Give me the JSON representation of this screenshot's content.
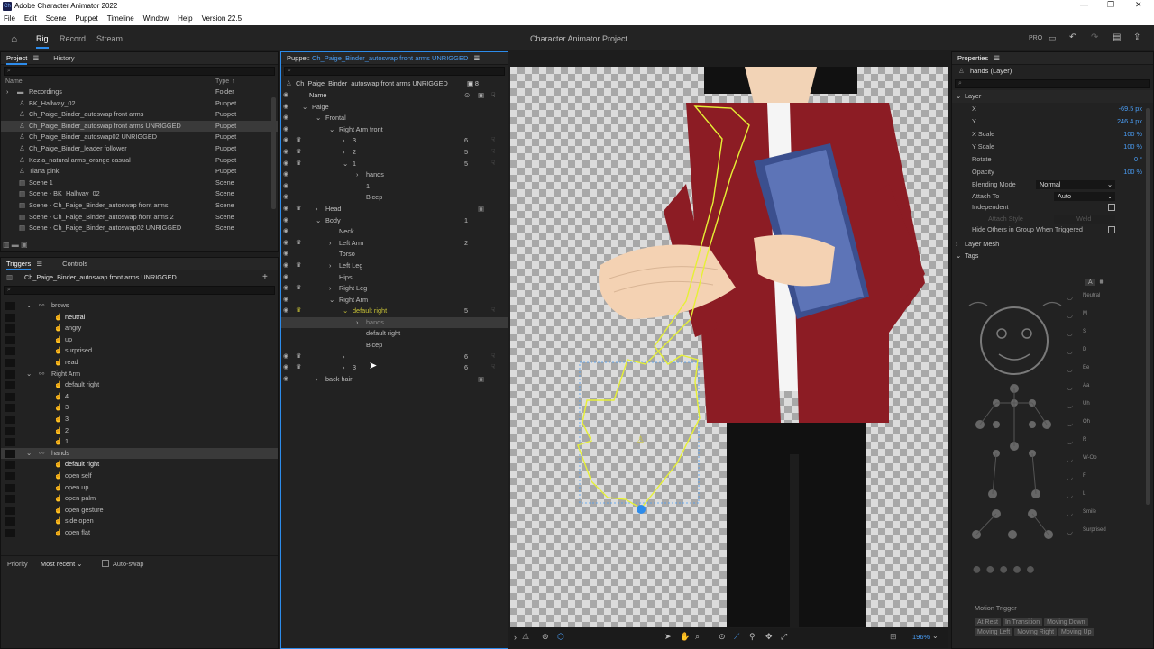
{
  "window": {
    "title": "Adobe Character Animator 2022"
  },
  "menu": [
    "File",
    "Edit",
    "Scene",
    "Puppet",
    "Timeline",
    "Window",
    "Help",
    "Version 22.5"
  ],
  "modes": {
    "rig": "Rig",
    "record": "Record",
    "stream": "Stream"
  },
  "project_title": "Character Animator Project",
  "pro": "PRO",
  "project_panel": {
    "tabs": {
      "project": "Project",
      "history": "History"
    },
    "col_name": "Name",
    "col_type": "Type",
    "items": [
      {
        "name": "Recordings",
        "type": "Folder"
      },
      {
        "name": "BK_Hallway_02",
        "type": "Puppet"
      },
      {
        "name": "Ch_Paige_Binder_autoswap front arms",
        "type": "Puppet"
      },
      {
        "name": "Ch_Paige_Binder_autoswap front arms UNRIGGED",
        "type": "Puppet"
      },
      {
        "name": "Ch_Paige_Binder_autoswap02 UNRIGGED",
        "type": "Puppet"
      },
      {
        "name": "Ch_Paige_Binder_leader follower",
        "type": "Puppet"
      },
      {
        "name": "Kezia_natural arms_orange casual",
        "type": "Puppet"
      },
      {
        "name": "Tiana pink",
        "type": "Puppet"
      },
      {
        "name": "Scene 1",
        "type": "Scene"
      },
      {
        "name": "Scene - BK_Hallway_02",
        "type": "Scene"
      },
      {
        "name": "Scene - Ch_Paige_Binder_autoswap front arms",
        "type": "Scene"
      },
      {
        "name": "Scene - Ch_Paige_Binder_autoswap front arms 2",
        "type": "Scene"
      },
      {
        "name": "Scene - Ch_Paige_Binder_autoswap02 UNRIGGED",
        "type": "Scene"
      }
    ]
  },
  "triggers_panel": {
    "tabs": {
      "triggers": "Triggers",
      "controls": "Controls"
    },
    "puppet": "Ch_Paige_Binder_autoswap front arms UNRIGGED",
    "rows": [
      {
        "label": "brows",
        "lvl": 0
      },
      {
        "label": "neutral",
        "lvl": 1
      },
      {
        "label": "angry",
        "lvl": 1
      },
      {
        "label": "up",
        "lvl": 1
      },
      {
        "label": "surprised",
        "lvl": 1
      },
      {
        "label": "read",
        "lvl": 1
      },
      {
        "label": "Right Arm",
        "lvl": 0
      },
      {
        "label": "default right",
        "lvl": 1
      },
      {
        "label": "4",
        "lvl": 1
      },
      {
        "label": "3",
        "lvl": 1
      },
      {
        "label": "3",
        "lvl": 1
      },
      {
        "label": "2",
        "lvl": 1
      },
      {
        "label": "1",
        "lvl": 1
      },
      {
        "label": "hands",
        "lvl": 0
      },
      {
        "label": "default right",
        "lvl": 1
      },
      {
        "label": "open self",
        "lvl": 1
      },
      {
        "label": "open up",
        "lvl": 1
      },
      {
        "label": "open palm",
        "lvl": 1
      },
      {
        "label": "open gesture",
        "lvl": 1
      },
      {
        "label": "side open",
        "lvl": 1
      },
      {
        "label": "open flat",
        "lvl": 1
      }
    ],
    "priority_label": "Priority",
    "priority_value": "Most recent",
    "autoswap": "Auto-swap"
  },
  "puppet_panel": {
    "tab_prefix": "Puppet:",
    "tab_name": "Ch_Paige_Binder_autoswap front arms UNRIGGED",
    "header": "Ch_Paige_Binder_autoswap front arms UNRIGGED",
    "header_count": "8",
    "col_name": "Name",
    "rows": [
      {
        "label": "Paige",
        "ind": 0,
        "arrow": "v",
        "n": ""
      },
      {
        "label": "Frontal",
        "ind": 1,
        "arrow": "v",
        "n": ""
      },
      {
        "label": "Right Arm front",
        "ind": 2,
        "arrow": "v",
        "n": ""
      },
      {
        "label": "3",
        "ind": 3,
        "arrow": ">",
        "n": "6"
      },
      {
        "label": "2",
        "ind": 3,
        "arrow": ">",
        "n": "5"
      },
      {
        "label": "1",
        "ind": 3,
        "arrow": "v",
        "n": "5"
      },
      {
        "label": "hands",
        "ind": 4,
        "arrow": ">",
        "n": ""
      },
      {
        "label": "1",
        "ind": 4,
        "arrow": "",
        "n": ""
      },
      {
        "label": "Bicep",
        "ind": 4,
        "arrow": "",
        "n": ""
      },
      {
        "label": "Head",
        "ind": 1,
        "arrow": ">",
        "n": ""
      },
      {
        "label": "Body",
        "ind": 1,
        "arrow": "v",
        "n": "1"
      },
      {
        "label": "Neck",
        "ind": 2,
        "arrow": "",
        "n": ""
      },
      {
        "label": "Left Arm",
        "ind": 2,
        "arrow": ">",
        "n": "2"
      },
      {
        "label": "Torso",
        "ind": 2,
        "arrow": "",
        "n": ""
      },
      {
        "label": "Left Leg",
        "ind": 2,
        "arrow": ">",
        "n": ""
      },
      {
        "label": "Hips",
        "ind": 2,
        "arrow": "",
        "n": ""
      },
      {
        "label": "Right Leg",
        "ind": 2,
        "arrow": ">",
        "n": ""
      },
      {
        "label": "Right Arm",
        "ind": 2,
        "arrow": "v",
        "n": ""
      },
      {
        "label": "default right",
        "ind": 3,
        "arrow": "v",
        "n": "5"
      },
      {
        "label": "hands",
        "ind": 4,
        "arrow": ">",
        "n": ""
      },
      {
        "label": "default right",
        "ind": 4,
        "arrow": "",
        "n": ""
      },
      {
        "label": "Bicep",
        "ind": 4,
        "arrow": "",
        "n": ""
      },
      {
        "label": "",
        "ind": 3,
        "arrow": ">",
        "n": "6"
      },
      {
        "label": "3",
        "ind": 3,
        "arrow": ">",
        "n": "6"
      },
      {
        "label": "back hair",
        "ind": 1,
        "arrow": ">",
        "n": ""
      }
    ],
    "zoom": "196%"
  },
  "properties": {
    "title": "Properties",
    "layer_name": "hands (Layer)",
    "section": "Layer",
    "rows": [
      {
        "label": "X",
        "value": "-69.5 px"
      },
      {
        "label": "Y",
        "value": "246.4 px"
      },
      {
        "label": "X Scale",
        "value": "100 %"
      },
      {
        "label": "Y Scale",
        "value": "100 %"
      },
      {
        "label": "Rotate",
        "value": "0 °"
      },
      {
        "label": "Opacity",
        "value": "100 %"
      }
    ],
    "blending_label": "Blending Mode",
    "blending_value": "Normal",
    "attach_label": "Attach To",
    "attach_value": "Auto",
    "independent": "Independent",
    "attach_style": "Attach Style",
    "attach_style_value": "Weld",
    "hide_others": "Hide Others in Group When Triggered",
    "layer_mesh": "Layer Mesh",
    "tags": "Tags",
    "tag_labels": [
      "Neutral",
      "M",
      "S",
      "D",
      "Ee",
      "Aa",
      "Uh",
      "Oh",
      "R",
      "W-Oo",
      "F",
      "L",
      "Smile",
      "Surprised"
    ],
    "motion_trigger": "Motion Trigger",
    "motion_tags": [
      "At Rest",
      "In Transition",
      "Moving Down",
      "Moving Left",
      "Moving Right",
      "Moving Up"
    ]
  }
}
